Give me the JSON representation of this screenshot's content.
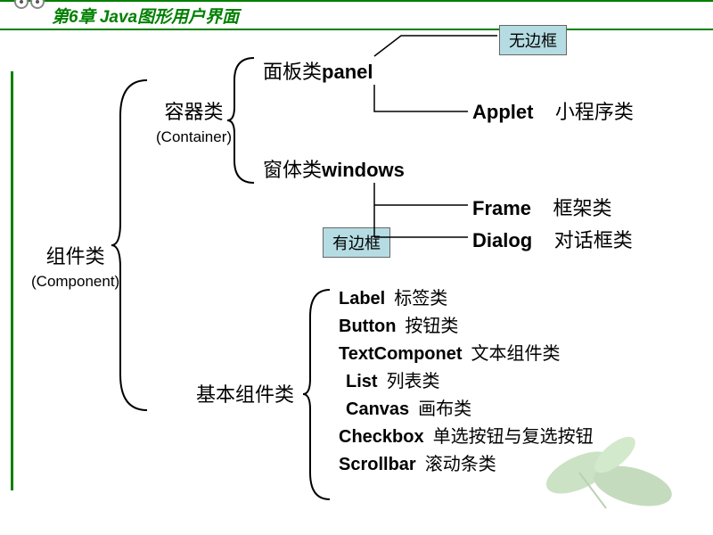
{
  "header": {
    "title": "第6章 Java图形用户界面"
  },
  "root": {
    "label_cn": "组件类",
    "label_en": "(Component)"
  },
  "container": {
    "label_cn": "容器类",
    "label_en": "(Container)"
  },
  "panel": {
    "label_cn": "面板类",
    "label_en": "panel"
  },
  "windows": {
    "label_cn": "窗体类",
    "label_en": "windows"
  },
  "callouts": {
    "no_border": "无边框",
    "has_border": "有边框"
  },
  "applet": {
    "en": "Applet",
    "cn": "小程序类"
  },
  "frame": {
    "en": "Frame",
    "cn": "框架类"
  },
  "dialog": {
    "en": "Dialog",
    "cn": "对话框类"
  },
  "basic": {
    "title": "基本组件类",
    "items": [
      {
        "en": "Label",
        "cn": "标签类"
      },
      {
        "en": "Button",
        "cn": "按钮类"
      },
      {
        "en": "TextComponet",
        "cn": "文本组件类"
      },
      {
        "en": "List",
        "cn": "列表类"
      },
      {
        "en": "Canvas",
        "cn": "画布类"
      },
      {
        "en": "Checkbox",
        "cn": "单选按钮与复选按钮"
      },
      {
        "en": "Scrollbar",
        "cn": "滚动条类"
      }
    ]
  }
}
